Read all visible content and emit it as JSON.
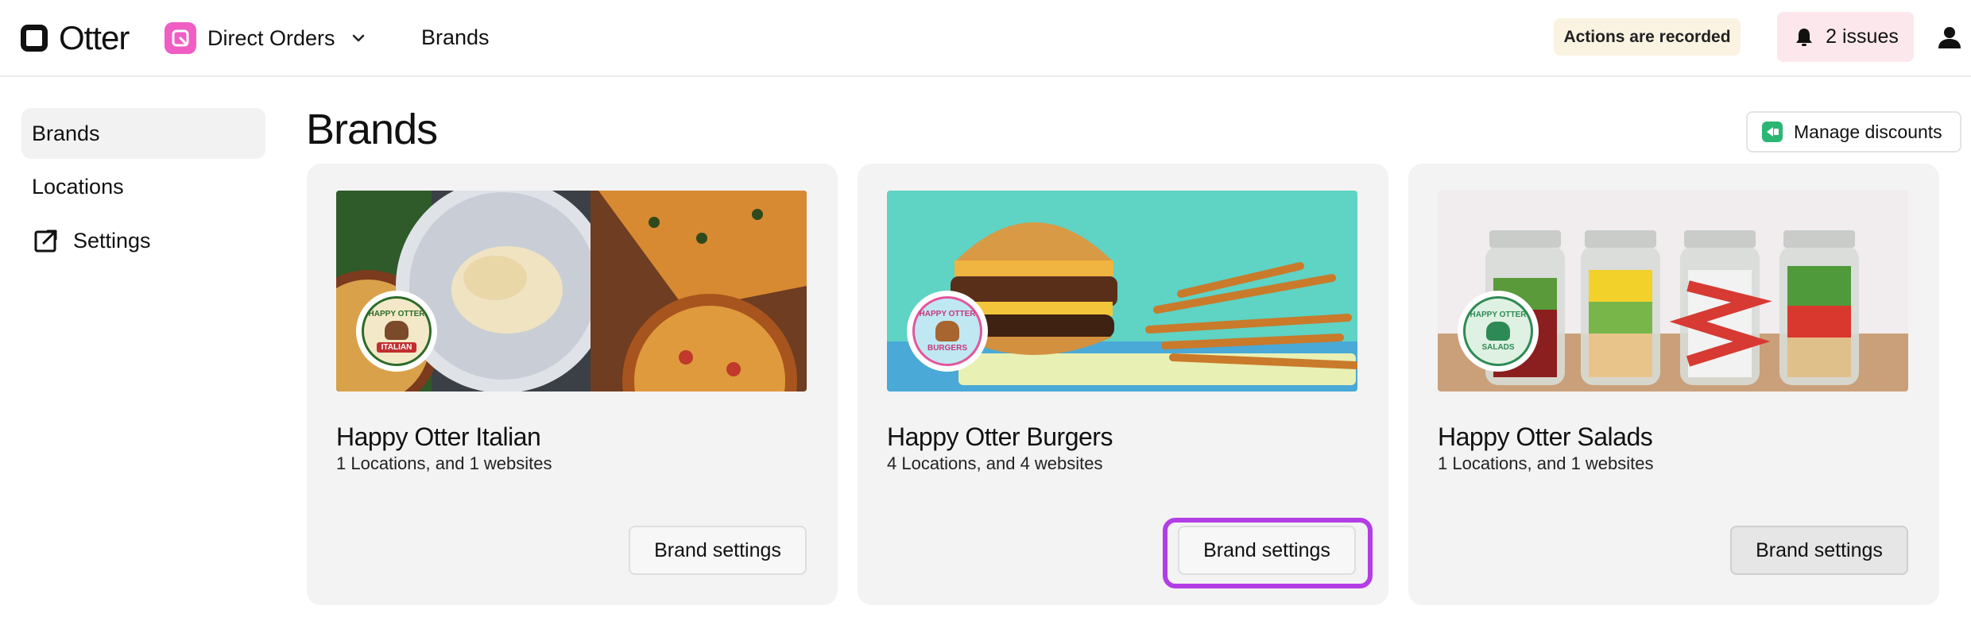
{
  "header": {
    "logo_text": "Otter",
    "app_name": "Direct Orders",
    "section": "Brands",
    "recorded_label": "Actions are recorded",
    "issues_label": "2 issues"
  },
  "sidebar": {
    "items": [
      {
        "label": "Brands",
        "active": true
      },
      {
        "label": "Locations",
        "active": false
      },
      {
        "label": "Settings",
        "active": false,
        "icon": "external-link-icon"
      }
    ]
  },
  "main": {
    "title": "Brands",
    "manage_discounts_label": "Manage discounts",
    "brands": [
      {
        "name": "Happy Otter Italian",
        "summary": "1 Locations, and 1 websites",
        "button": "Brand settings",
        "badge_top": "HAPPY OTTER",
        "badge_bottom": "ITALIAN"
      },
      {
        "name": "Happy Otter Burgers",
        "summary": "4 Locations, and 4 websites",
        "button": "Brand settings",
        "badge_top": "HAPPY OTTER",
        "badge_bottom": "BURGERS"
      },
      {
        "name": "Happy Otter Salads",
        "summary": "1 Locations, and 1 websites",
        "button": "Brand settings",
        "badge_top": "HAPPY OTTER",
        "badge_bottom": "SALADS"
      }
    ]
  },
  "colors": {
    "app_icon": "#f05ec4",
    "focus_ring": "#b33ee6",
    "issues_bg": "#fce8ec",
    "recorded_bg": "#fbf3e2",
    "discount_icon": "#2bb673"
  }
}
